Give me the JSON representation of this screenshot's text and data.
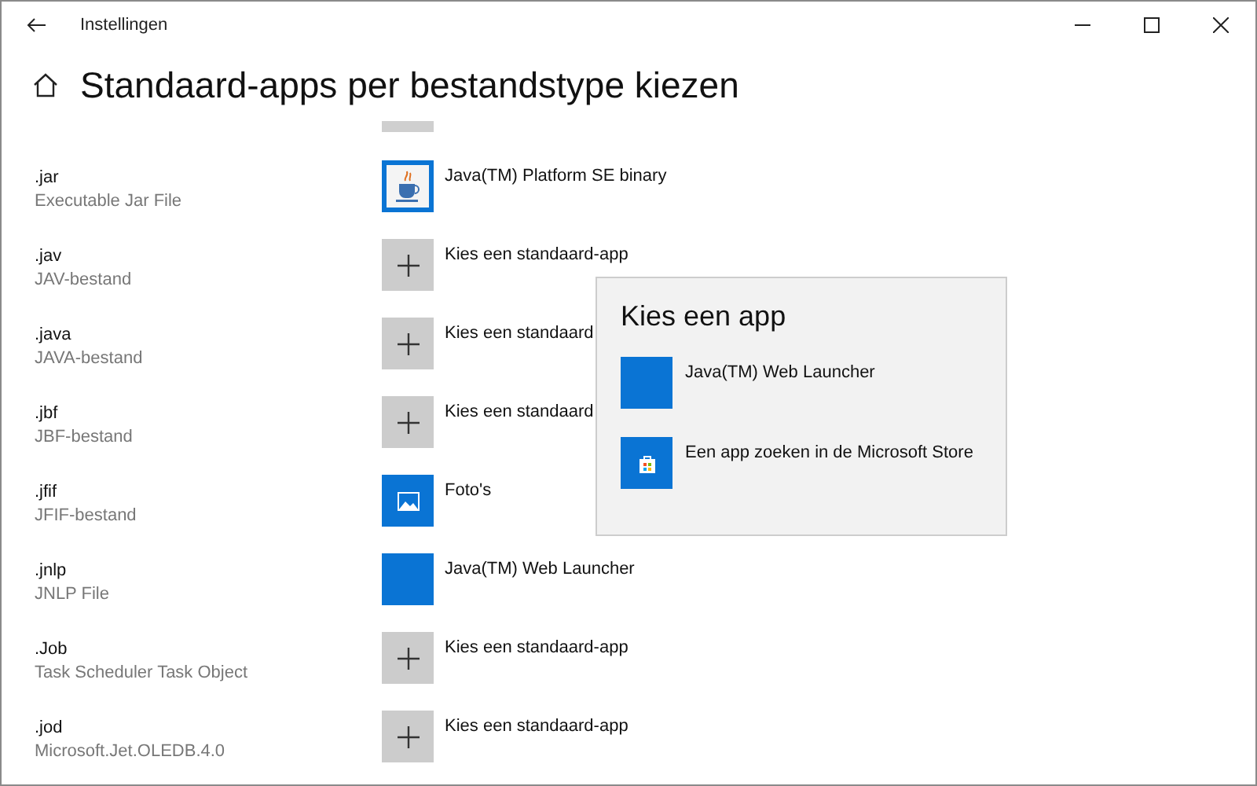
{
  "window": {
    "title": "Instellingen"
  },
  "page": {
    "title": "Standaard-apps per bestandstype kiezen"
  },
  "rows": [
    {
      "extension": ".jar",
      "description": "Executable Jar File",
      "app": {
        "kind": "java",
        "name": "Java(TM) Platform SE binary"
      }
    },
    {
      "extension": ".jav",
      "description": "JAV-bestand",
      "app": {
        "kind": "plus",
        "name": "Kies een standaard-app"
      }
    },
    {
      "extension": ".java",
      "description": "JAVA-bestand",
      "app": {
        "kind": "plus",
        "name": "Kies een standaard"
      }
    },
    {
      "extension": ".jbf",
      "description": "JBF-bestand",
      "app": {
        "kind": "plus",
        "name": "Kies een standaard"
      }
    },
    {
      "extension": ".jfif",
      "description": "JFIF-bestand",
      "app": {
        "kind": "photos",
        "name": "Foto's"
      }
    },
    {
      "extension": ".jnlp",
      "description": "JNLP File",
      "app": {
        "kind": "blank",
        "name": "Java(TM) Web Launcher"
      }
    },
    {
      "extension": ".Job",
      "description": "Task Scheduler Task Object",
      "app": {
        "kind": "plus",
        "name": "Kies een standaard-app"
      }
    },
    {
      "extension": ".jod",
      "description": "Microsoft.Jet.OLEDB.4.0",
      "app": {
        "kind": "plus",
        "name": "Kies een standaard-app"
      }
    }
  ],
  "popup": {
    "title": "Kies een app",
    "items": [
      {
        "kind": "blank",
        "label": "Java(TM) Web Launcher"
      },
      {
        "kind": "store",
        "label": "Een app zoeken in de Microsoft Store"
      }
    ]
  }
}
